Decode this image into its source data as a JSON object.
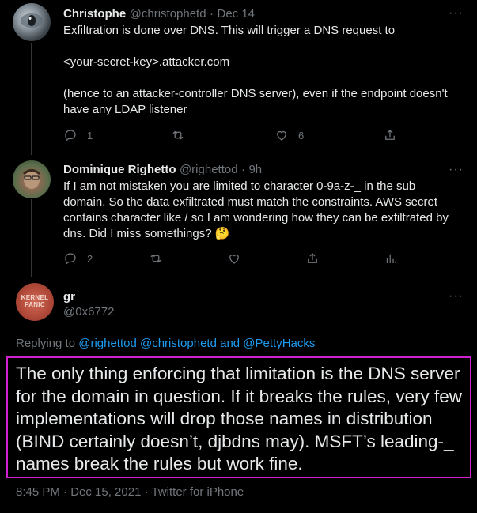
{
  "tweets": [
    {
      "name": "Christophe",
      "handle": "@christophetd",
      "sep": "·",
      "time": "Dec 14",
      "body": "Exfiltration is done over DNS. This will trigger a DNS request to\n\n<your-secret-key>.attacker.com\n\n(hence to an attacker-controller DNS server), even if the endpoint doesn't have any LDAP listener",
      "reply_count": "1",
      "like_count": "6"
    },
    {
      "name": "Dominique Righetto",
      "handle": "@righettod",
      "sep": "·",
      "time": "9h",
      "body": "If I am not mistaken you are limited to character 0-9a-z-_ in the sub domain. So the data exfiltrated must match the constraints. AWS secret contains character like / so I am wondering how they can be exfiltrated by dns. Did I miss somethings? 🤔",
      "reply_count": "2"
    }
  ],
  "main_tweet": {
    "name": "gr",
    "handle": "@0x6772",
    "avatar_text": "KERNEL PANIC",
    "replying_prefix": "Replying to ",
    "replying_links": "@righettod @christophetd and @PettyHacks",
    "body": "The only thing enforcing that limitation is the DNS server for the domain in question. If it breaks the rules, very few implementations will drop those names in distribution (BIND certainly doesn’t, djbdns may). MSFT’s leading-_ names break the rules but work fine.",
    "meta": "8:45 PM · Dec 15, 2021 · Twitter for iPhone"
  },
  "more_label": "···",
  "colors": {
    "background": "#000000",
    "text": "#e7e9ea",
    "secondary": "#71767b",
    "link": "#1d9bf0",
    "highlight_border": "#d020d0"
  }
}
